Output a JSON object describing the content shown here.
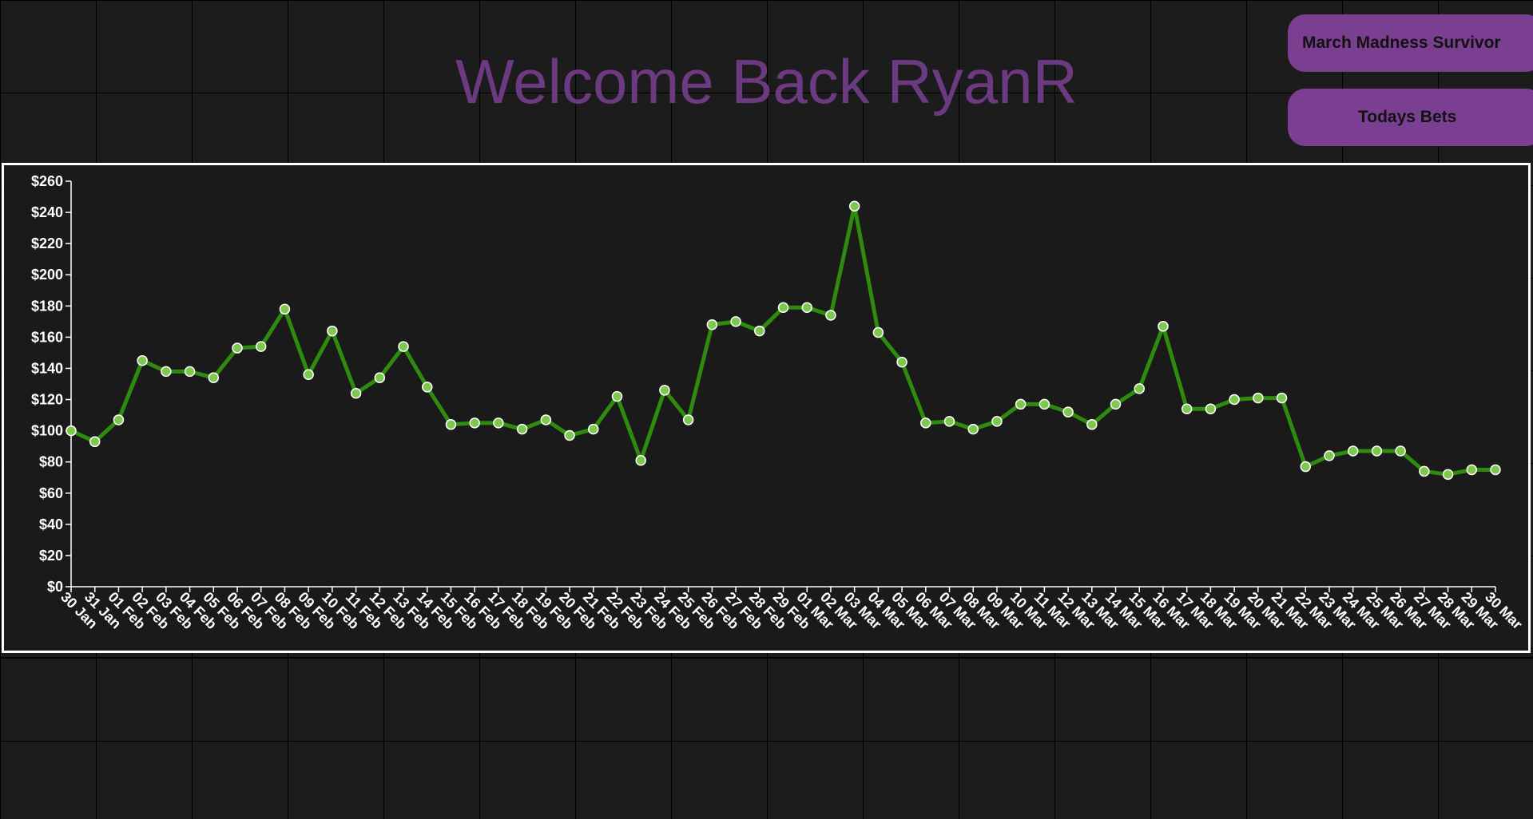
{
  "header": {
    "welcome_text": "Welcome Back RyanR"
  },
  "nav": {
    "survivor_label": "March Madness Survivor",
    "bets_label": "Todays Bets"
  },
  "colors": {
    "background": "#1c1c1c",
    "accent_purple": "#7b3f91",
    "title_purple": "#6b3a80",
    "line_green": "#2e8b0f",
    "point_fill": "#7ec850"
  },
  "chart_data": {
    "type": "line",
    "title": "",
    "xlabel": "",
    "ylabel": "",
    "ylim": [
      0,
      260
    ],
    "yticks": [
      "$0",
      "$20",
      "$40",
      "$60",
      "$80",
      "$100",
      "$120",
      "$140",
      "$160",
      "$180",
      "$200",
      "$220",
      "$240",
      "$260"
    ],
    "grid": false,
    "categories": [
      "30 Jan",
      "31 Jan",
      "01 Feb",
      "02 Feb",
      "03 Feb",
      "04 Feb",
      "05 Feb",
      "06 Feb",
      "07 Feb",
      "08 Feb",
      "09 Feb",
      "10 Feb",
      "11 Feb",
      "12 Feb",
      "13 Feb",
      "14 Feb",
      "15 Feb",
      "16 Feb",
      "17 Feb",
      "18 Feb",
      "19 Feb",
      "20 Feb",
      "21 Feb",
      "22 Feb",
      "23 Feb",
      "24 Feb",
      "25 Feb",
      "26 Feb",
      "27 Feb",
      "28 Feb",
      "29 Feb",
      "01 Mar",
      "02 Mar",
      "03 Mar",
      "04 Mar",
      "05 Mar",
      "06 Mar",
      "07 Mar",
      "08 Mar",
      "09 Mar",
      "10 Mar",
      "11 Mar",
      "12 Mar",
      "13 Mar",
      "14 Mar",
      "15 Mar",
      "16 Mar",
      "17 Mar",
      "18 Mar",
      "19 Mar",
      "20 Mar",
      "21 Mar",
      "22 Mar",
      "23 Mar",
      "24 Mar",
      "25 Mar",
      "26 Mar",
      "27 Mar",
      "28 Mar",
      "29 Mar",
      "30 Mar"
    ],
    "values": [
      100,
      93,
      107,
      145,
      138,
      138,
      134,
      153,
      154,
      178,
      136,
      164,
      124,
      134,
      154,
      128,
      104,
      105,
      105,
      101,
      107,
      97,
      101,
      122,
      81,
      126,
      107,
      168,
      170,
      164,
      179,
      179,
      174,
      244,
      163,
      144,
      105,
      106,
      101,
      106,
      117,
      117,
      112,
      104,
      117,
      127,
      167,
      114,
      114,
      120,
      121,
      121,
      77,
      84,
      87,
      87,
      87,
      74,
      72,
      75,
      75
    ]
  }
}
